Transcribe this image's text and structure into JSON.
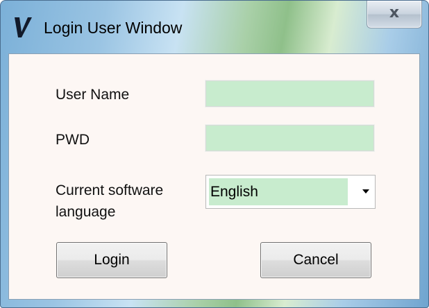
{
  "window": {
    "title": "Login User Window",
    "app_icon": "v-logo-icon",
    "close_label": "x"
  },
  "form": {
    "username_label": "User Name",
    "username_value": "",
    "password_label": "PWD",
    "password_value": "",
    "language_label_line1": "Current software",
    "language_label_line2": "language",
    "language_selected": "English"
  },
  "buttons": {
    "login_label": "Login",
    "cancel_label": "Cancel"
  },
  "colors": {
    "field_background": "#c8ecce",
    "client_background": "#fdf7f4"
  }
}
